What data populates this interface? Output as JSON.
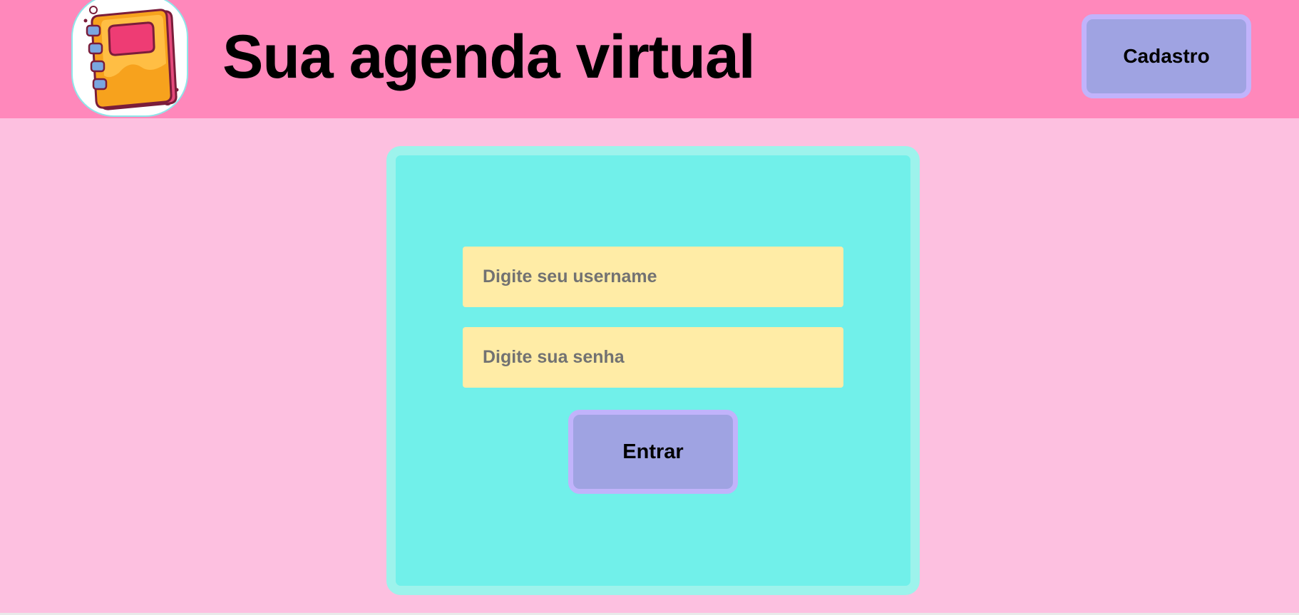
{
  "header": {
    "logo_icon": "notebook-icon",
    "title": "Sua agenda virtual",
    "cadastro_label": "Cadastro",
    "background_color": "#ff88bb"
  },
  "login_form": {
    "username_placeholder": "Digite seu username",
    "username_value": "",
    "password_placeholder": "Digite sua senha",
    "password_value": "",
    "submit_label": "Entrar",
    "card_color": "#71f0ea",
    "input_color": "#ffeca6",
    "button_color": "#9fa3e2"
  },
  "page": {
    "background_color": "#fdc0e0"
  }
}
